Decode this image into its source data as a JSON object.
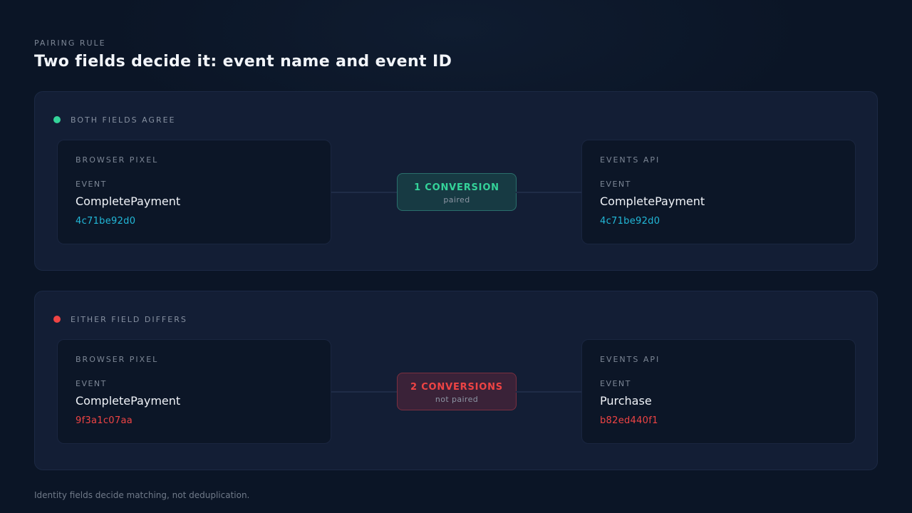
{
  "header": {
    "eyebrow": "PAIRING RULE",
    "title": "Two fields decide it: event name and event ID"
  },
  "panels": [
    {
      "label": "BOTH FIELDS AGREE",
      "status_color": "#34d399",
      "left": {
        "source": "BROWSER PIXEL",
        "event_label": "EVENT",
        "event_name": "CompletePayment",
        "event_id": "4c71be92d0"
      },
      "right": {
        "source": "EVENTS API",
        "event_label": "EVENT",
        "event_name": "CompletePayment",
        "event_id": "4c71be92d0"
      },
      "badge": {
        "main": "1 CONVERSION",
        "sub": "paired"
      }
    },
    {
      "label": "EITHER FIELD DIFFERS",
      "status_color": "#ef4444",
      "left": {
        "source": "BROWSER PIXEL",
        "event_label": "EVENT",
        "event_name": "CompletePayment",
        "event_id": "9f3a1c07aa"
      },
      "right": {
        "source": "EVENTS API",
        "event_label": "EVENT",
        "event_name": "Purchase",
        "event_id": "b82ed440f1"
      },
      "badge": {
        "main": "2 CONVERSIONS",
        "sub": "not paired"
      }
    }
  ],
  "colors": {
    "agree": "#34d399",
    "differ": "#ef4444",
    "id_match": "#22b8d8"
  },
  "footnote": "Identity fields decide matching, not deduplication."
}
